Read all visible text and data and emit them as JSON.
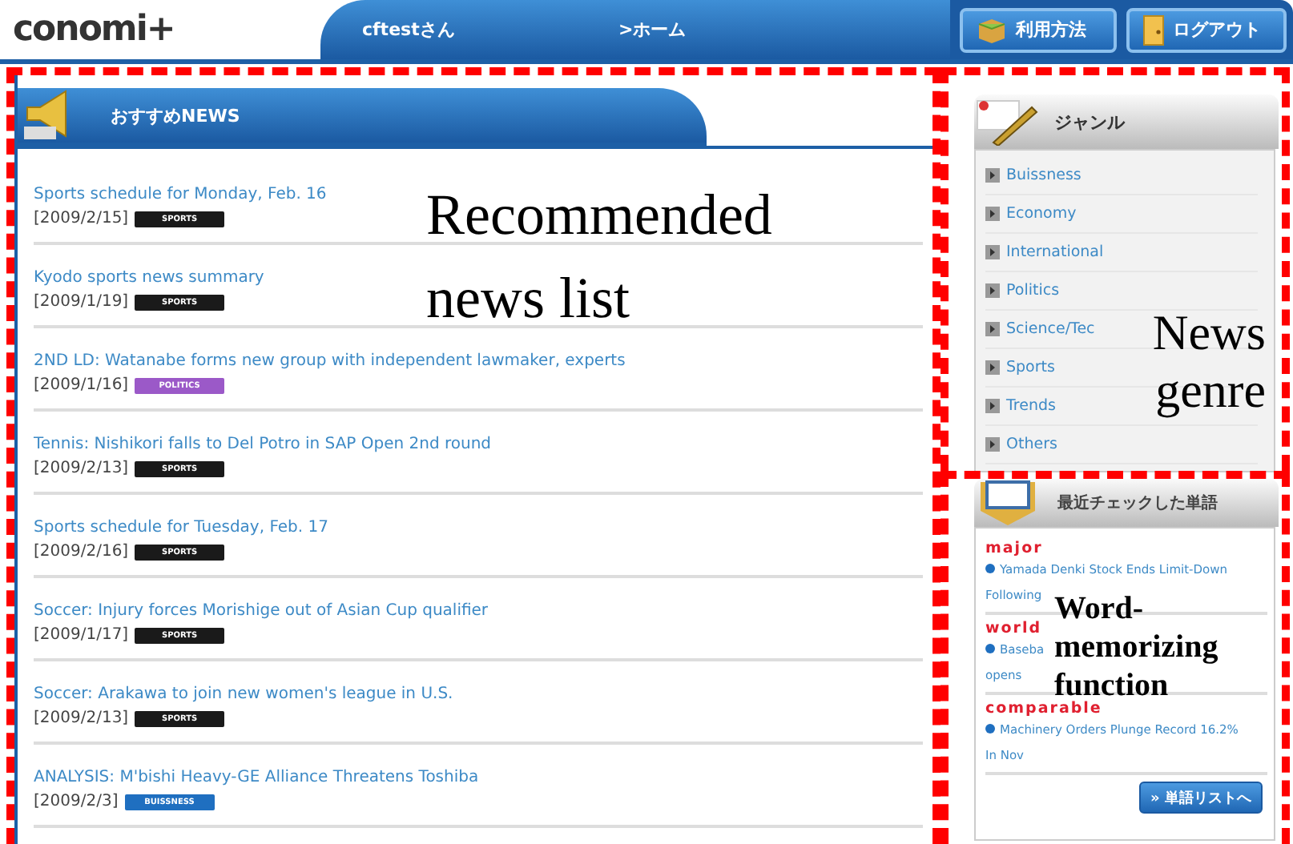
{
  "header": {
    "logo": "conomi+",
    "user": "cftestさん",
    "home_link": ">ホーム",
    "buttons": [
      {
        "label": "利用方法",
        "kind": "help"
      },
      {
        "label": "ログアウト",
        "kind": "logout"
      }
    ]
  },
  "news": {
    "title": "おすすめNEWS",
    "items": [
      {
        "title": "Sports schedule for Monday, Feb. 16",
        "date": "[2009/2/15]",
        "tag": {
          "label": "SPORTS",
          "color": "#1a1a1a"
        }
      },
      {
        "title": "Kyodo sports news summary",
        "date": "[2009/1/19]",
        "tag": {
          "label": "SPORTS",
          "color": "#1a1a1a"
        }
      },
      {
        "title": "2ND LD: Watanabe forms new group with independent lawmaker, experts",
        "date": "[2009/1/16]",
        "tag": {
          "label": "POLITICS",
          "color": "#9b59c8"
        }
      },
      {
        "title": "Tennis: Nishikori falls to Del Potro in SAP Open 2nd round",
        "date": "[2009/2/13]",
        "tag": {
          "label": "SPORTS",
          "color": "#1a1a1a"
        }
      },
      {
        "title": "Sports schedule for Tuesday, Feb. 17",
        "date": "[2009/2/16]",
        "tag": {
          "label": "SPORTS",
          "color": "#1a1a1a"
        }
      },
      {
        "title": "Soccer: Injury forces Morishige out of Asian Cup qualifier",
        "date": "[2009/1/17]",
        "tag": {
          "label": "SPORTS",
          "color": "#1a1a1a"
        }
      },
      {
        "title": "Soccer: Arakawa to join new women's league in U.S.",
        "date": "[2009/2/13]",
        "tag": {
          "label": "SPORTS",
          "color": "#1a1a1a"
        }
      },
      {
        "title": "ANALYSIS: M'bishi Heavy-GE Alliance Threatens Toshiba",
        "date": "[2009/2/3]",
        "tag": {
          "label": "BUISSNESS",
          "color": "#1f6fc0"
        }
      }
    ]
  },
  "genre": {
    "title": "ジャンル",
    "items": [
      "Buissness",
      "Economy",
      "International",
      "Politics",
      "Science/Tec",
      "Sports",
      "Trends",
      "Others"
    ]
  },
  "words": {
    "title": "最近チェックした単語",
    "entries": [
      {
        "word": "major",
        "lines": [
          "Yamada Denki Stock Ends Limit-Down",
          "Following"
        ]
      },
      {
        "word": "world",
        "lines": [
          "Baseba",
          "opens"
        ]
      },
      {
        "word": "comparable",
        "lines": [
          "Machinery Orders Plunge Record 16.2%",
          "In Nov"
        ]
      }
    ],
    "button": "» 単語リストへ"
  },
  "annotations": [
    {
      "text": "Recommended news list",
      "kind": "news"
    },
    {
      "text": "News genre",
      "kind": "genre"
    },
    {
      "text": "Word-memorizing function",
      "kind": "words"
    }
  ]
}
